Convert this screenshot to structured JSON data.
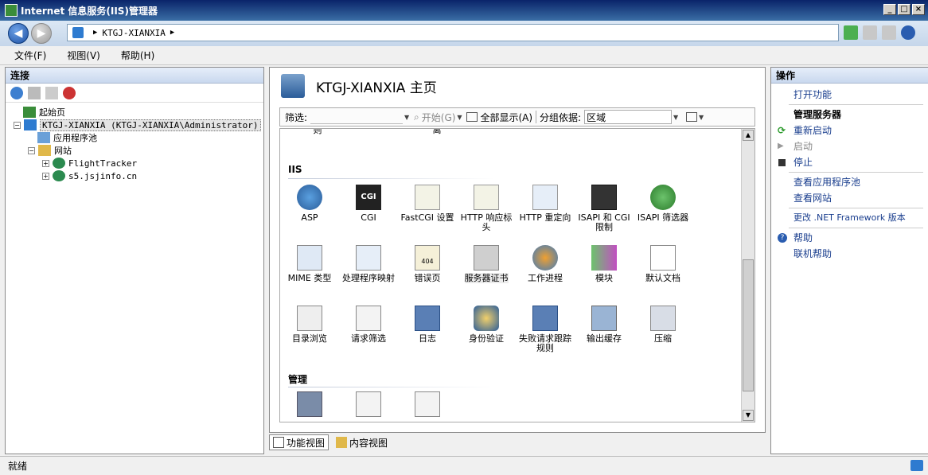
{
  "window": {
    "title": "Internet 信息服务(IIS)管理器",
    "controls": [
      "_",
      "□",
      "×"
    ]
  },
  "address": {
    "segments": [
      "KTGJ-XIANXIA"
    ]
  },
  "menu": {
    "items": [
      "文件(F)",
      "视图(V)",
      "帮助(H)"
    ]
  },
  "connections": {
    "title": "连接",
    "tree": [
      {
        "label": "起始页",
        "depth": 0
      },
      {
        "label": "KTGJ-XIANXIA (KTGJ-XIANXIA\\Administrator)",
        "depth": 0,
        "selected": true
      },
      {
        "label": "应用程序池",
        "depth": 1
      },
      {
        "label": "网站",
        "depth": 1
      },
      {
        "label": "FlightTracker",
        "depth": 2
      },
      {
        "label": "s5.jsjinfo.cn",
        "depth": 2
      }
    ]
  },
  "center": {
    "title": "KTGJ-XIANXIA 主页",
    "filter": {
      "label": "筛选:",
      "start": "开始(G)",
      "show_all": "全部显示(A)",
      "group_label": "分组依据:",
      "group_value": "区域"
    },
    "cut_labels": [
      "则",
      "",
      "离"
    ],
    "sections": [
      {
        "title": "IIS",
        "rows": [
          [
            "ASP",
            "CGI",
            "FastCGI 设置",
            "HTTP 响应标头",
            "HTTP 重定向",
            "ISAPI 和 CGI 限制",
            "ISAPI 筛选器"
          ],
          [
            "MIME 类型",
            "处理程序映射",
            "错误页",
            "服务器证书",
            "工作进程",
            "模块",
            "默认文档"
          ],
          [
            "目录浏览",
            "请求筛选",
            "日志",
            "身份验证",
            "失败请求跟踪规则",
            "输出缓存",
            "压缩"
          ]
        ]
      },
      {
        "title": "管理"
      }
    ],
    "tabs": [
      {
        "label": "功能视图",
        "active": true
      },
      {
        "label": "内容视图",
        "active": false
      }
    ]
  },
  "actions": {
    "title": "操作",
    "items": [
      {
        "label": "打开功能",
        "kind": "link"
      },
      {
        "label": "管理服务器",
        "kind": "header"
      },
      {
        "label": "重新启动",
        "kind": "link",
        "icon": "restart-icon"
      },
      {
        "label": "启动",
        "kind": "disabled",
        "icon": "start-icon"
      },
      {
        "label": "停止",
        "kind": "link",
        "icon": "stop-icon"
      },
      {
        "label": "查看应用程序池",
        "kind": "link"
      },
      {
        "label": "查看网站",
        "kind": "link"
      },
      {
        "label": "更改 .NET Framework 版本",
        "kind": "link"
      },
      {
        "label": "帮助",
        "kind": "link",
        "icon": "help-icon"
      },
      {
        "label": "联机帮助",
        "kind": "link"
      }
    ]
  },
  "status": {
    "text": "就绪"
  }
}
